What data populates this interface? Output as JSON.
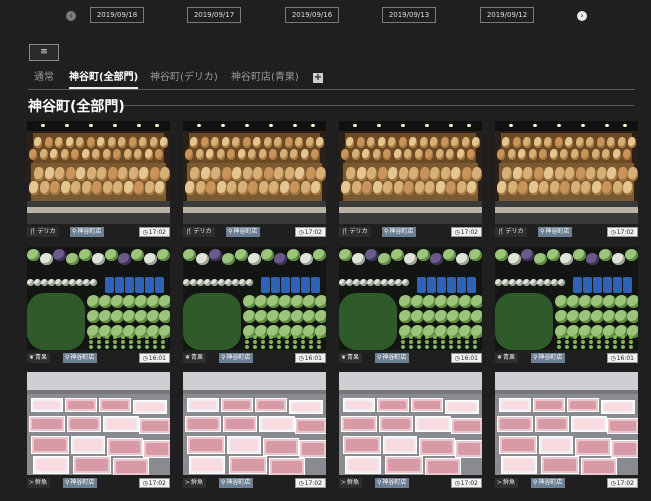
{
  "date_nav": {
    "prev_icon": "chevron-left-icon",
    "next_icon": "chevron-right-icon",
    "dates": [
      "2019/09/18",
      "2019/09/17",
      "2019/09/16",
      "2019/09/13",
      "2019/09/12"
    ]
  },
  "menu_button": {
    "label": "≡"
  },
  "tabs": [
    {
      "label": "通常",
      "active": false
    },
    {
      "label": "神谷町(全部門)",
      "active": true
    },
    {
      "label": "神谷町(デリカ)",
      "active": false
    },
    {
      "label": "神谷町店(青果)",
      "active": false
    }
  ],
  "add_tab_label": "+",
  "section_title": "神谷町(全部門)",
  "colors": {
    "background": "#1f1f1f",
    "store_chip": "#6b7e92",
    "time_chip": "#f2f2f2"
  },
  "rows": [
    {
      "photo": "bread",
      "category": "デリカ",
      "category_icon": "fork-knife-icon",
      "store": "神谷町店",
      "time": "17:02",
      "count": 4
    },
    {
      "photo": "vegetables",
      "category": "青果",
      "category_icon": "leaf-icon",
      "store": "神谷町店",
      "time": "16:01",
      "count": 4
    },
    {
      "photo": "fish",
      "category": "鮮魚",
      "category_icon": "fish-icon",
      "store": "神谷町店",
      "time": "17:02",
      "count": 4
    }
  ]
}
